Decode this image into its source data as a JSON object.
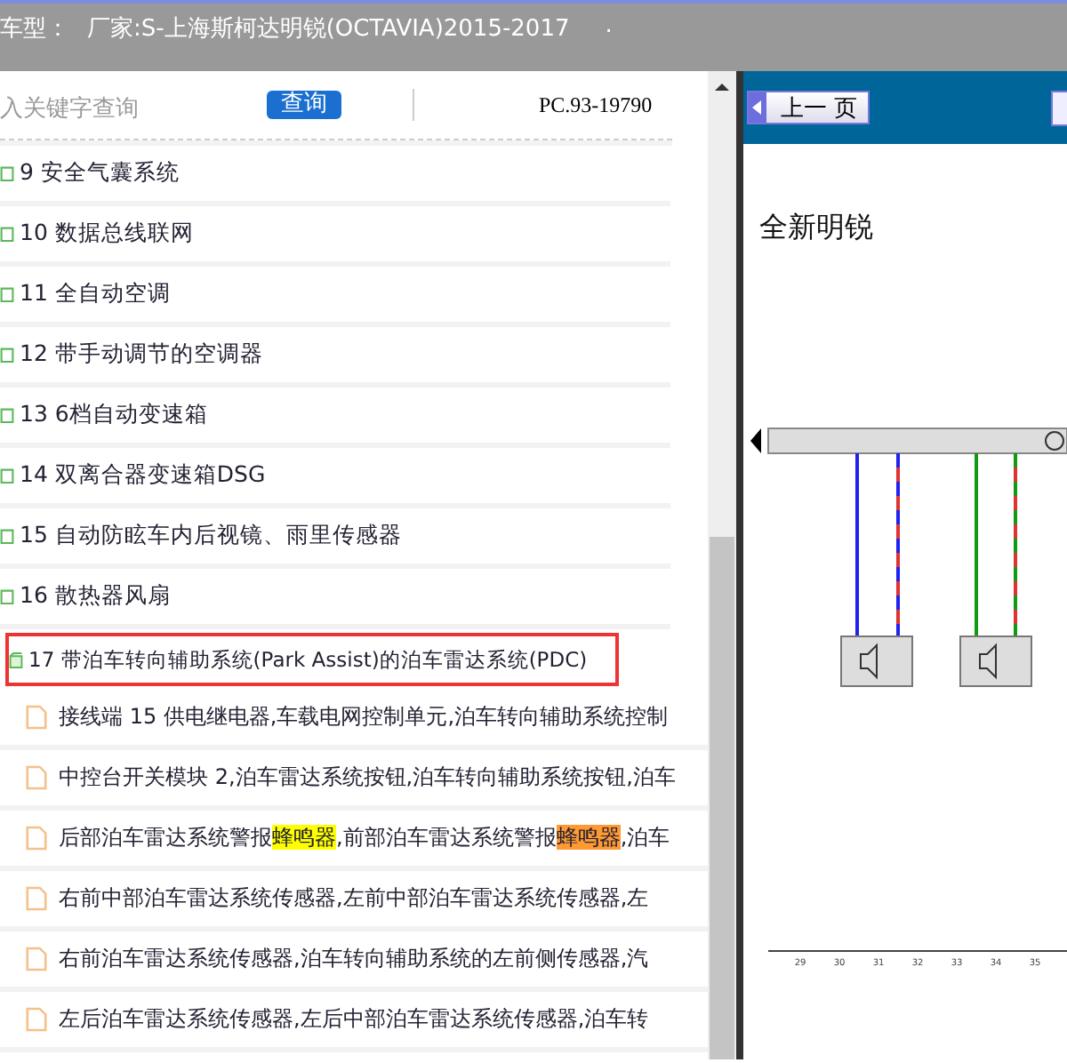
{
  "header": {
    "label": "车型：",
    "value": "厂家:S-上海斯柯达明锐(OCTAVIA)2015-2017",
    "trail": "."
  },
  "search": {
    "placeholder": "入关键字查询",
    "button": "查询",
    "code": "PC.93-19790"
  },
  "tree": [
    {
      "label": "9 安全气囊系统",
      "expanded": false,
      "selected": false
    },
    {
      "label": "10 数据总线联网",
      "expanded": false,
      "selected": false
    },
    {
      "label": "11 全自动空调",
      "expanded": false,
      "selected": false
    },
    {
      "label": "12 带手动调节的空调器",
      "expanded": false,
      "selected": false
    },
    {
      "label": "13 6档自动变速箱",
      "expanded": false,
      "selected": false
    },
    {
      "label": "14 双离合器变速箱DSG",
      "expanded": false,
      "selected": false
    },
    {
      "label": "15 自动防眩车内后视镜、雨里传感器",
      "expanded": false,
      "selected": false
    },
    {
      "label": "16 散热器风扇",
      "expanded": false,
      "selected": false
    },
    {
      "label": "17 带泊车转向辅助系统(Park Assist)的泊车雷达系统(PDC)",
      "expanded": true,
      "selected": true,
      "children": [
        {
          "parts": [
            {
              "text": "接线端 15 供电继电器,车载电网控制单元,泊车转向辅助系统控制"
            }
          ]
        },
        {
          "parts": [
            {
              "text": "中控台开关模块 2,泊车雷达系统按钮,泊车转向辅助系统按钮,泊车"
            }
          ]
        },
        {
          "parts": [
            {
              "text": "后部泊车雷达系统警报"
            },
            {
              "text": "蜂鸣器",
              "color": "#ffff00"
            },
            {
              "text": ",前部泊车雷达系统警报"
            },
            {
              "text": "蜂鸣器",
              "color": "#ff9933"
            },
            {
              "text": ",泊车"
            }
          ]
        },
        {
          "parts": [
            {
              "text": "右前中部泊车雷达系统传感器,左前中部泊车雷达系统传感器,左"
            }
          ]
        },
        {
          "parts": [
            {
              "text": "右前泊车雷达系统传感器,泊车转向辅助系统的左前侧传感器,汽"
            }
          ]
        },
        {
          "parts": [
            {
              "text": "左后泊车雷达系统传感器,左后中部泊车雷达系统传感器,泊车转"
            }
          ]
        }
      ]
    }
  ],
  "viewer": {
    "prev_button": "上一 页",
    "title": "全新明锐",
    "scale_labels": [
      "29",
      "30",
      "31",
      "32",
      "33",
      "34",
      "35"
    ]
  }
}
